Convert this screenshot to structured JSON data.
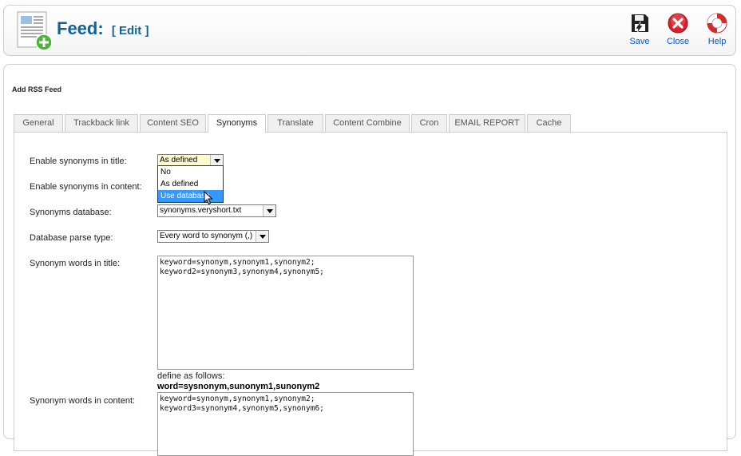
{
  "header": {
    "title": "Feed:",
    "edit_label": "[ Edit ]",
    "buttons": {
      "save": "Save",
      "close": "Close",
      "help": "Help"
    }
  },
  "main": {
    "legend": "Add RSS Feed",
    "tabs": [
      {
        "label": "General"
      },
      {
        "label": "Trackback link"
      },
      {
        "label": "Content SEO"
      },
      {
        "label": "Synonyms"
      },
      {
        "label": "Translate"
      },
      {
        "label": "Content Combine"
      },
      {
        "label": "Cron"
      },
      {
        "label": "EMAIL REPORT"
      },
      {
        "label": "Cache"
      }
    ],
    "active_tab": "Synonyms",
    "form": {
      "enable_title": {
        "label": "Enable synonyms in title:",
        "value": "As defined"
      },
      "enable_content": {
        "label": "Enable synonyms in content:"
      },
      "database": {
        "label": "Synonyms database:",
        "value": "synonyms.veryshort.txt"
      },
      "parse_type": {
        "label": "Database parse type:",
        "value": "Every word to synonym (,)"
      },
      "words_title": {
        "label": "Synonym words in title:",
        "value": "keyword=synonym,synonym1,synonym2;\nkeyword2=synonym3,synonym4,synonym5;"
      },
      "hint": "define as follows:",
      "hint_example": "word=sysnonym,sunonym1,sunonym2",
      "words_content": {
        "label": "Synonym words in content:",
        "value": "keyword=synonym,synonym1,synonym2;\nkeyword3=synonym4,synonym5,synonym6;"
      }
    },
    "dropdown_options": [
      {
        "label": "No"
      },
      {
        "label": "As defined"
      },
      {
        "label": "Use database"
      }
    ]
  }
}
